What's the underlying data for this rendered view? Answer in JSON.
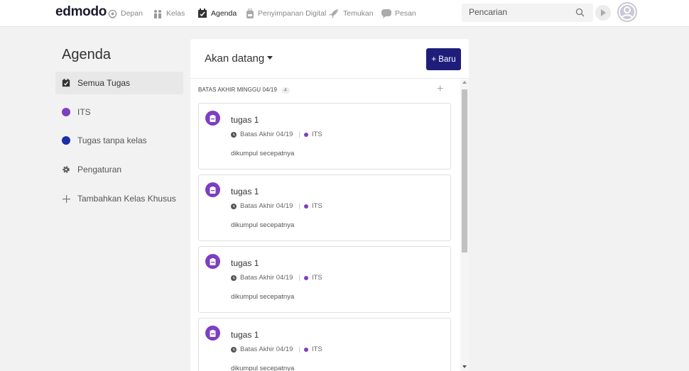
{
  "brand": {
    "logo": "edmodo"
  },
  "nav": [
    {
      "label": "Depan",
      "icon": "home-icon"
    },
    {
      "label": "Kelas",
      "icon": "classes-icon"
    },
    {
      "label": "Agenda",
      "icon": "calendar-icon",
      "active": true
    },
    {
      "label": "Penyimpanan Digital",
      "icon": "backpack-icon"
    },
    {
      "label": "Temukan",
      "icon": "rocket-icon"
    },
    {
      "label": "Pesan",
      "icon": "chat-icon"
    }
  ],
  "search": {
    "placeholder": "Pencarian"
  },
  "sidebar": {
    "title": "Agenda",
    "items": [
      {
        "label": "Semua Tugas",
        "icon": "calendar-check-icon",
        "active": true
      },
      {
        "label": "ITS",
        "icon": "class-color-dot",
        "color": "#7d3fc1"
      },
      {
        "label": "Tugas tanpa kelas",
        "icon": "class-color-dot",
        "color": "#1a2fa8"
      },
      {
        "label": "Pengaturan",
        "icon": "gear-icon"
      },
      {
        "label": "Tambahkan Kelas Khusus",
        "icon": "plus-icon"
      }
    ]
  },
  "main": {
    "filter_label": "Akan datang",
    "new_button": "+ Baru",
    "week": {
      "label": "BATAS AKHIR MINGGU 04/19",
      "count": "4"
    },
    "cards": [
      {
        "title": "tugas 1",
        "due": "Batas Akhir 04/19",
        "class": "ITS",
        "description": "dikumpul secepatnya"
      },
      {
        "title": "tugas 1",
        "due": "Batas Akhir 04/19",
        "class": "ITS",
        "description": "dikumpul secepatnya"
      },
      {
        "title": "tugas 1",
        "due": "Batas Akhir 04/19",
        "class": "ITS",
        "description": "dikumpul secepatnya"
      },
      {
        "title": "tugas 1",
        "due": "Batas Akhir 04/19",
        "class": "ITS",
        "description": "dikumpul secepatnya"
      }
    ]
  },
  "colors": {
    "accent": "#1e1e7a",
    "class_purple": "#7d3fc1",
    "class_blue": "#1a2fa8"
  }
}
